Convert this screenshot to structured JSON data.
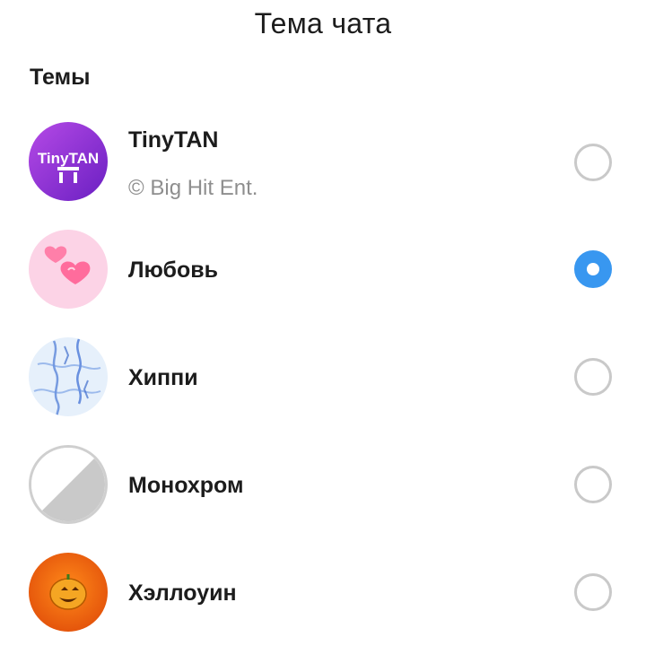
{
  "header": {
    "title": "Тема чата"
  },
  "section": {
    "label": "Темы"
  },
  "themes": [
    {
      "title": "TinyTAN",
      "subtitle": "© Big Hit Ent.",
      "logo_text": "TinyTAN",
      "icon": "tinytan-thumbnail-icon",
      "selected": false,
      "accent": "#8e33d6"
    },
    {
      "title": "Любовь",
      "icon": "love-hearts-thumbnail-icon",
      "selected": true,
      "accent": "#f7a8c8"
    },
    {
      "title": "Хиппи",
      "icon": "hippie-tiedye-thumbnail-icon",
      "selected": false,
      "accent": "#4a78d8"
    },
    {
      "title": "Монохром",
      "icon": "monochrome-thumbnail-icon",
      "selected": false,
      "accent": "#c9c9c9"
    },
    {
      "title": "Хэллоуин",
      "icon": "halloween-pumpkin-thumbnail-icon",
      "selected": false,
      "accent": "#ea5b0c"
    }
  ],
  "colors": {
    "radio_selected": "#3897f0",
    "radio_border": "#c9c9c9",
    "subtitle": "#8e8e8e"
  }
}
